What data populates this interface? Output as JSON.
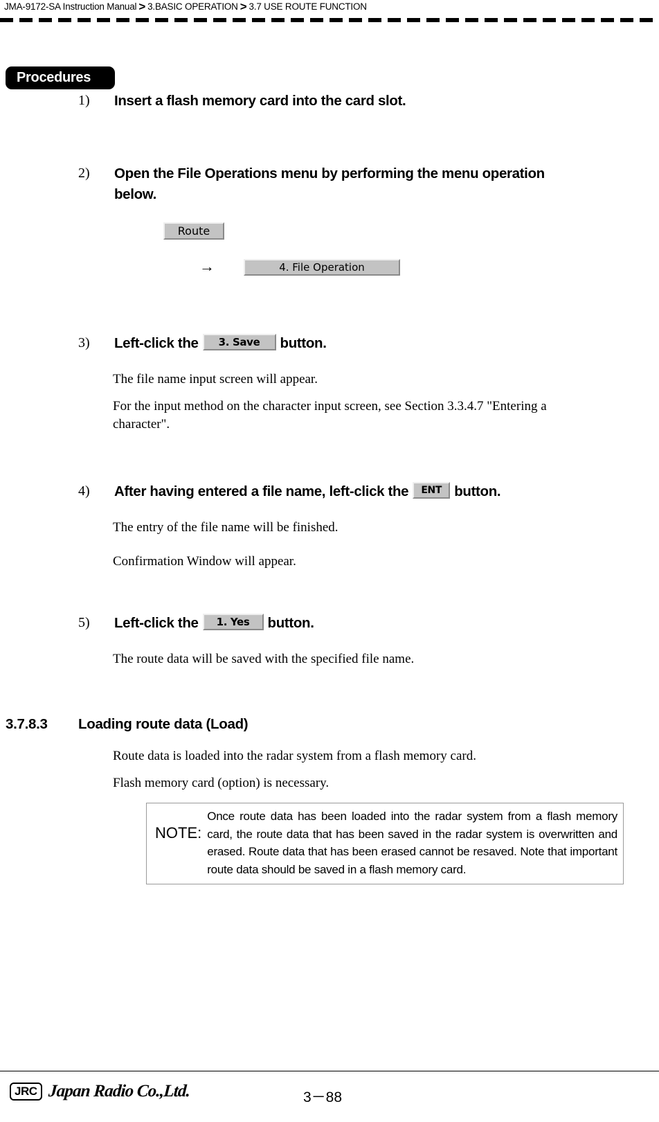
{
  "header": {
    "manual": "JMA-9172-SA Instruction Manual",
    "separator": ">",
    "chapter": "3.BASIC OPERATION",
    "section": "3.7  USE ROUTE FUNCTION"
  },
  "procedures": {
    "badge_label": "Procedures",
    "steps": [
      {
        "number": "1)",
        "heading": "Insert a flash memory card into the card slot."
      },
      {
        "number": "2)",
        "heading": "Open the File Operations menu by performing the menu operation below.",
        "menu_button": "Route",
        "arrow": "→",
        "menu_item": "4. File Operation"
      },
      {
        "number": "3)",
        "heading_before": "Left-click the",
        "button": "3. Save",
        "heading_after": "button.",
        "body_lines": [
          "The file name input screen will appear.",
          "For the input method on the character input screen, see Section 3.3.4.7 \"Entering a character\"."
        ]
      },
      {
        "number": "4)",
        "heading_before": "After having entered a file name, left-click the",
        "button": "ENT",
        "heading_after": "button.",
        "body_lines": [
          "The entry of the file name will be finished.",
          "Confirmation Window will appear."
        ]
      },
      {
        "number": "5)",
        "heading_before": "Left-click the",
        "button": "1. Yes",
        "heading_after": "button.",
        "body_lines": [
          "The route data will be saved with the specified file name."
        ]
      }
    ]
  },
  "section_3783": {
    "number": "3.7.8.3",
    "title": "Loading route data (Load)",
    "paragraphs": [
      "Route data is loaded into the radar system from a flash memory card.",
      "Flash memory card (option) is necessary."
    ],
    "note": {
      "label": "NOTE:",
      "text": "Once route data has been loaded into the radar system from a flash memory card, the route data that has been saved in the radar system is overwritten and erased. Route data that has been erased cannot be resaved. Note that important route data should be saved in a flash memory card."
    }
  },
  "footer": {
    "company_mark": "JRC",
    "company_name": "Japan Radio Co.,Ltd.",
    "page_number": "3－88"
  }
}
